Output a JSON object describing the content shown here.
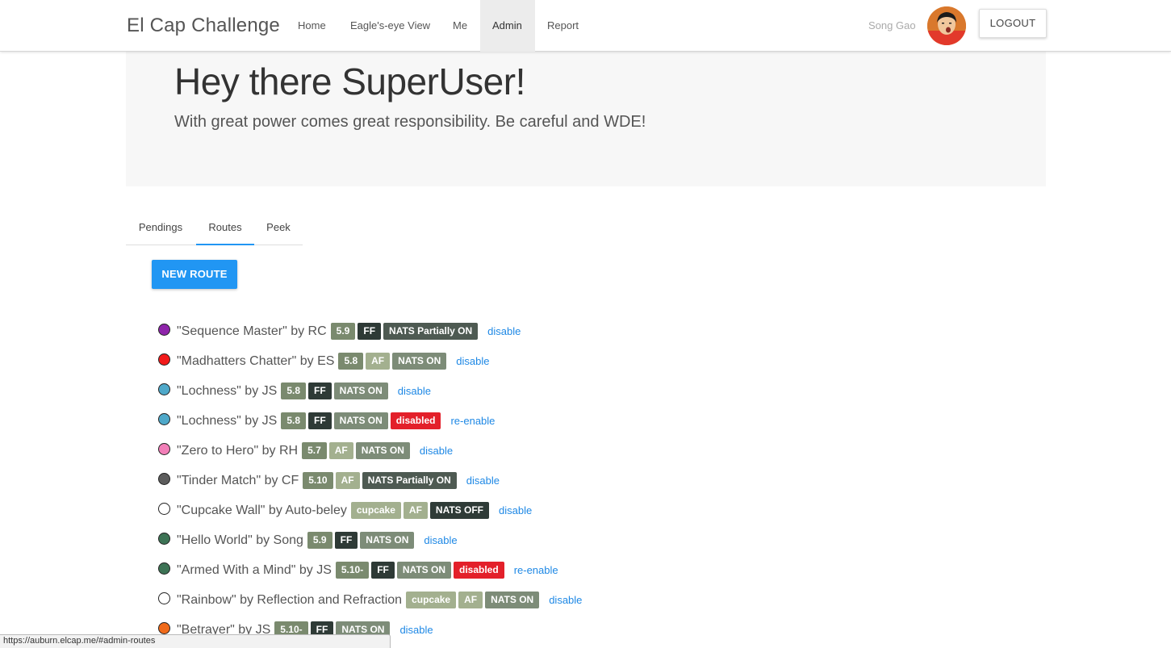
{
  "colors": {
    "accent": "#2196f3",
    "link": "#1e88e5",
    "disabled_badge": "#e3202a",
    "badge_grade": "#7a8a6e",
    "badge_ff": "#2e3a36",
    "badge_af": "#a3b08f",
    "badge_nats_on": "#7d8c78",
    "badge_nats_partial": "#4e5a52",
    "badge_nats_off": "#2f3b37",
    "badge_cupcake": "#a3b08f"
  },
  "nav": {
    "brand": "El Cap Challenge",
    "links": [
      "Home",
      "Eagle's-eye View",
      "Me",
      "Admin",
      "Report"
    ],
    "active": "Admin",
    "user_name": "Song Gao",
    "logout_label": "LOGOUT"
  },
  "hero": {
    "title": "Hey there SuperUser!",
    "subtitle": "With great power comes great responsibility. Be careful and WDE!"
  },
  "tabs": [
    "Pendings",
    "Routes",
    "Peek"
  ],
  "active_tab": "Routes",
  "new_route_label": "NEW ROUTE",
  "routes": [
    {
      "name": "\"Sequence Master\" by RC",
      "color": "#8e24aa",
      "badges": [
        {
          "text": "5.9",
          "kind": "grade"
        },
        {
          "text": "FF",
          "kind": "ff"
        },
        {
          "text": "NATS Partially ON",
          "kind": "nats_partial"
        }
      ],
      "action": "disable"
    },
    {
      "name": "\"Madhatters Chatter\" by ES",
      "color": "#f21a1a",
      "badges": [
        {
          "text": "5.8",
          "kind": "grade"
        },
        {
          "text": "AF",
          "kind": "af"
        },
        {
          "text": "NATS ON",
          "kind": "nats_on"
        }
      ],
      "action": "disable"
    },
    {
      "name": "\"Lochness\" by JS",
      "color": "#4ea8c9",
      "badges": [
        {
          "text": "5.8",
          "kind": "grade"
        },
        {
          "text": "FF",
          "kind": "ff"
        },
        {
          "text": "NATS ON",
          "kind": "nats_on"
        }
      ],
      "action": "disable"
    },
    {
      "name": "\"Lochness\" by JS",
      "color": "#4ea8c9",
      "badges": [
        {
          "text": "5.8",
          "kind": "grade"
        },
        {
          "text": "FF",
          "kind": "ff"
        },
        {
          "text": "NATS ON",
          "kind": "nats_on"
        },
        {
          "text": "disabled",
          "kind": "disabled"
        }
      ],
      "action": "re-enable"
    },
    {
      "name": "\"Zero to Hero\" by RH",
      "color": "#f27fb8",
      "badges": [
        {
          "text": "5.7",
          "kind": "grade"
        },
        {
          "text": "AF",
          "kind": "af"
        },
        {
          "text": "NATS ON",
          "kind": "nats_on"
        }
      ],
      "action": "disable"
    },
    {
      "name": "\"Tinder Match\" by CF",
      "color": "#5c5c5c",
      "badges": [
        {
          "text": "5.10",
          "kind": "grade"
        },
        {
          "text": "AF",
          "kind": "af"
        },
        {
          "text": "NATS Partially ON",
          "kind": "nats_partial"
        }
      ],
      "action": "disable"
    },
    {
      "name": "\"Cupcake Wall\" by Auto-beley",
      "color": "#ffffff",
      "badges": [
        {
          "text": "cupcake",
          "kind": "cupcake"
        },
        {
          "text": "AF",
          "kind": "af"
        },
        {
          "text": "NATS OFF",
          "kind": "nats_off"
        }
      ],
      "action": "disable"
    },
    {
      "name": "\"Hello World\" by Song",
      "color": "#3d7355",
      "badges": [
        {
          "text": "5.9",
          "kind": "grade"
        },
        {
          "text": "FF",
          "kind": "ff"
        },
        {
          "text": "NATS ON",
          "kind": "nats_on"
        }
      ],
      "action": "disable"
    },
    {
      "name": "\"Armed With a Mind\" by JS",
      "color": "#3d7355",
      "badges": [
        {
          "text": "5.10-",
          "kind": "grade"
        },
        {
          "text": "FF",
          "kind": "ff"
        },
        {
          "text": "NATS ON",
          "kind": "nats_on"
        },
        {
          "text": "disabled",
          "kind": "disabled"
        }
      ],
      "action": "re-enable"
    },
    {
      "name": "\"Rainbow\" by Reflection and Refraction",
      "color": "#ffffff",
      "badges": [
        {
          "text": "cupcake",
          "kind": "cupcake"
        },
        {
          "text": "AF",
          "kind": "af"
        },
        {
          "text": "NATS ON",
          "kind": "nats_on"
        }
      ],
      "action": "disable"
    },
    {
      "name": "\"Betrayer\" by JS",
      "color": "#f06a1a",
      "badges": [
        {
          "text": "5.10-",
          "kind": "grade"
        },
        {
          "text": "FF",
          "kind": "ff"
        },
        {
          "text": "NATS ON",
          "kind": "nats_on"
        }
      ],
      "action": "disable"
    }
  ],
  "status_url": "https://auburn.elcap.me/#admin-routes"
}
